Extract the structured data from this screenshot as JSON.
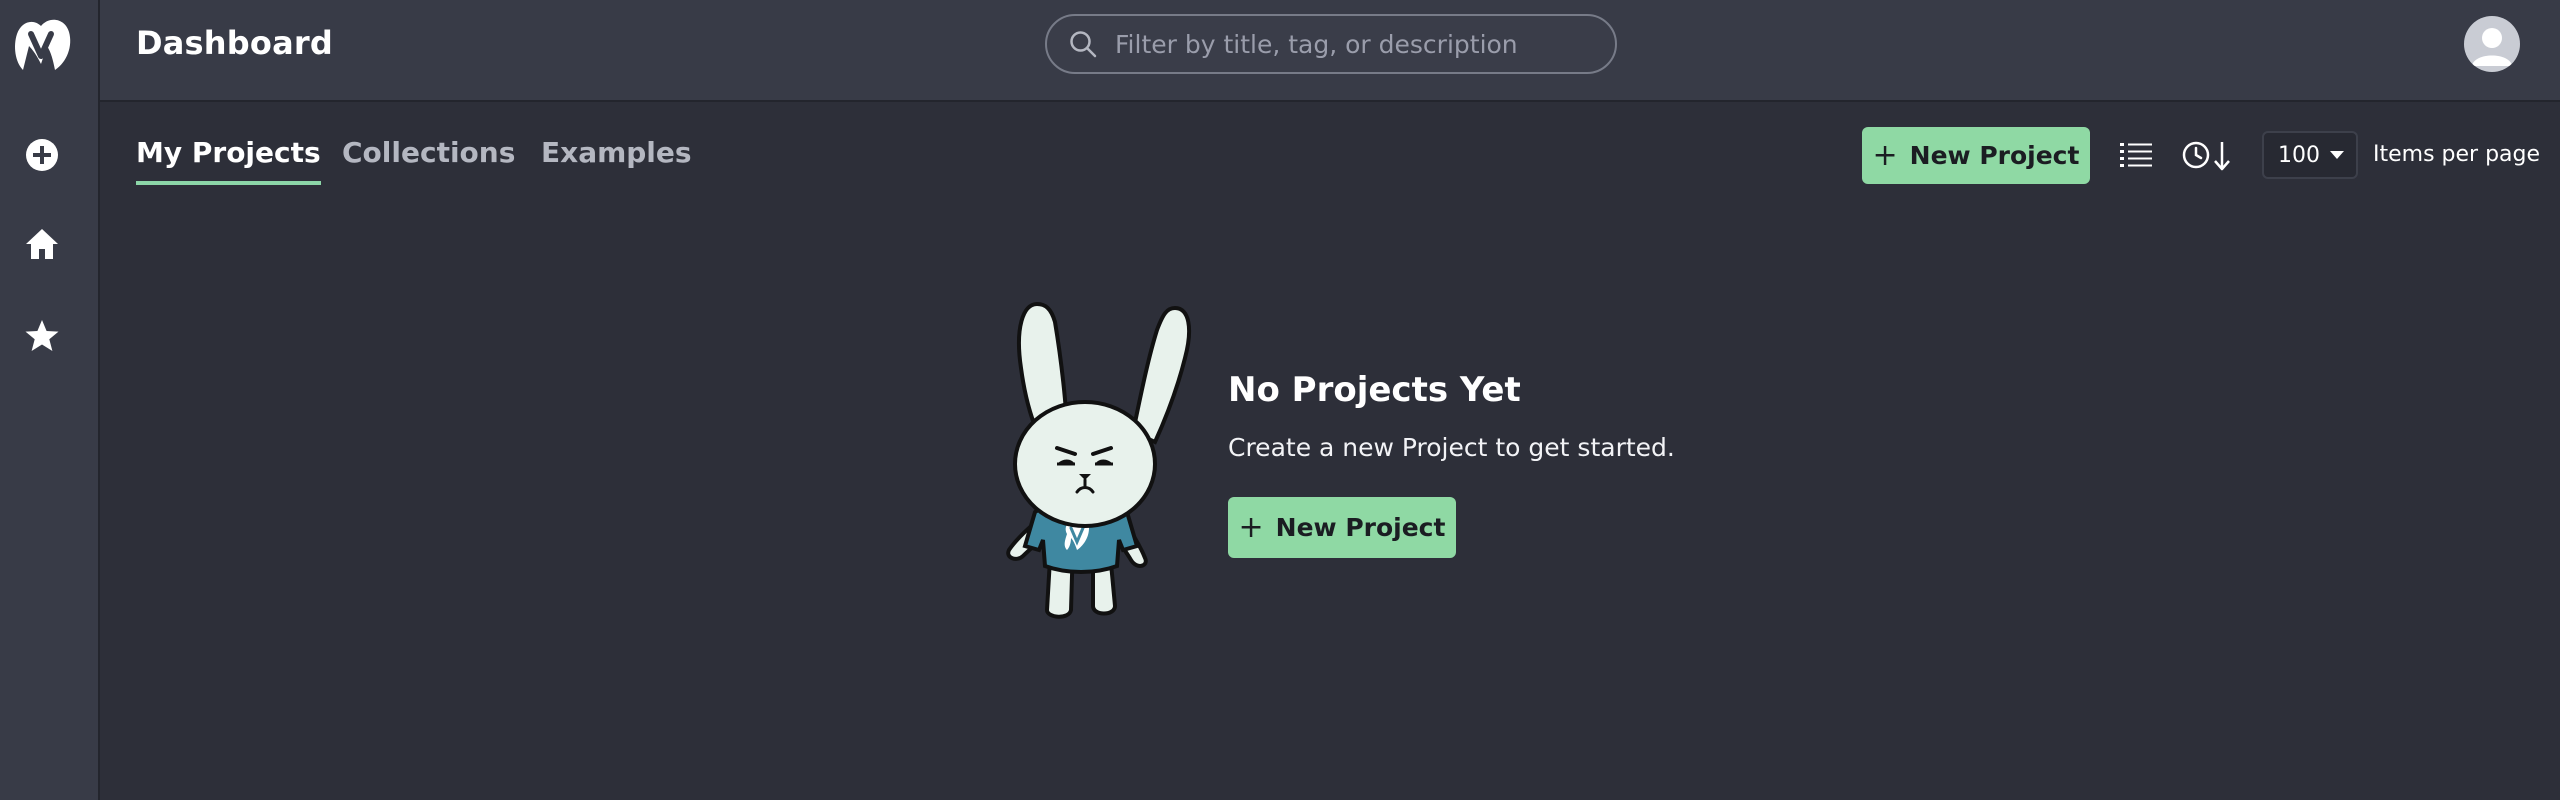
{
  "header": {
    "title": "Dashboard",
    "search_placeholder": "Filter by title, tag, or description"
  },
  "sidebar": {
    "logo": "app-logo-icon",
    "items": [
      {
        "icon": "add-circle-icon",
        "name": "new"
      },
      {
        "icon": "home-icon",
        "name": "home"
      },
      {
        "icon": "star-icon",
        "name": "favorites"
      }
    ]
  },
  "tabs": [
    {
      "label": "My Projects",
      "active": true
    },
    {
      "label": "Collections",
      "active": false
    },
    {
      "label": "Examples",
      "active": false
    }
  ],
  "toolbar": {
    "new_project_label": "New Project",
    "list_view_icon": "list-view-icon",
    "sort_icon": "sort-by-recent-icon",
    "items_per_page_value": "100",
    "items_per_page_label": "Items per page"
  },
  "empty_state": {
    "title": "No Projects Yet",
    "description": "Create a new Project to get started.",
    "button_label": "New Project"
  },
  "colors": {
    "accent": "#8fd9a4",
    "background": "#2d2f39",
    "sidebar_header": "#383b47"
  }
}
